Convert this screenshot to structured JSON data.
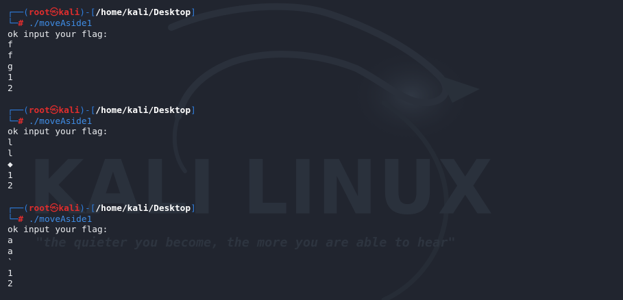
{
  "wallpaper": {
    "logo_text": "KALI LINUX",
    "tagline": "\"the quieter you become, the more you are able to hear\""
  },
  "prompt": {
    "corner_top": "┌──(",
    "user": "root",
    "skull": "㉿",
    "host": "kali",
    "sep": ")-[",
    "cwd": "/home/kali/Desktop",
    "close": "]",
    "corner_bottom": "└─",
    "hash": "#"
  },
  "sessions": [
    {
      "command": " ./moveAside1",
      "output": [
        "ok input your flag:",
        "f",
        "f",
        "g",
        "1",
        "2"
      ]
    },
    {
      "command": " ./moveAside1",
      "output": [
        "ok input your flag:",
        "l",
        "l",
        "◆",
        "1",
        "2"
      ]
    },
    {
      "command": " ./moveAside1",
      "output": [
        "ok input your flag:",
        "a",
        "a",
        "`",
        "1",
        "2"
      ]
    }
  ]
}
